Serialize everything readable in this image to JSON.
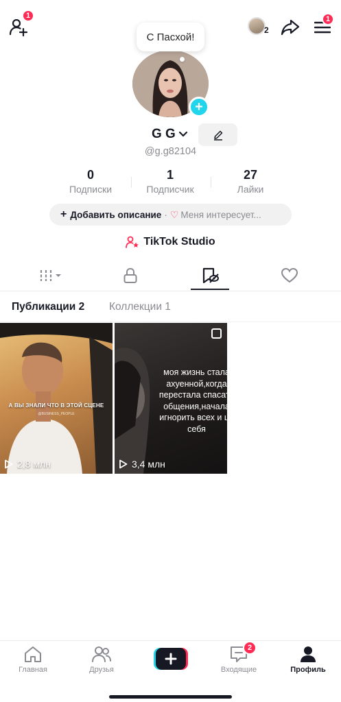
{
  "top_bar": {
    "add_friends_badge": "1",
    "stories_count": "2",
    "menu_badge": "1"
  },
  "profile": {
    "note_bubble": "С Пасхой!",
    "name": "G G",
    "handle": "@g.g82104",
    "stats": [
      {
        "value": "0",
        "label": "Подписки"
      },
      {
        "value": "1",
        "label": "Подписчик"
      },
      {
        "value": "27",
        "label": "Лайки"
      }
    ],
    "add_description": "Добавить описание",
    "separator": "·",
    "interests": "Меня интересует...",
    "studio_label": "TikTok Studio"
  },
  "subtabs": {
    "posts": "Публикации 2",
    "collections": "Коллекции 1"
  },
  "videos": [
    {
      "views": "2,8 млн",
      "caption": "А ВЫ ЗНАЛИ ЧТО В ЭТОЙ СЦЕНЕ",
      "watermark": "@BUSINESS_PEOPLE"
    },
    {
      "views": "3,4 млн",
      "caption": "моя жизнь стала ахуенной,когда перестала спасать общения,начала игнорить всех и це себя"
    }
  ],
  "bottom_nav": {
    "home": "Главная",
    "friends": "Друзья",
    "inbox": "Входящие",
    "inbox_badge": "2",
    "profile": "Профиль"
  },
  "colors": {
    "accent_red": "#fe2c55",
    "accent_cyan": "#20d5ec",
    "text_primary": "#161823",
    "text_secondary": "#8a8b91"
  }
}
